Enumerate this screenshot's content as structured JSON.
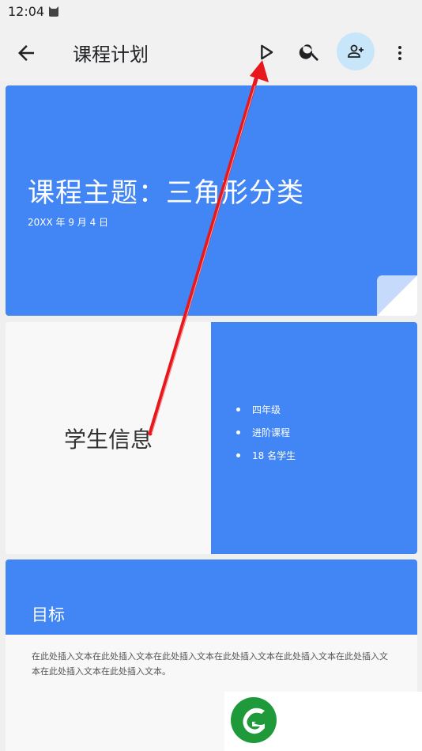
{
  "status": {
    "time": "12:04"
  },
  "appbar": {
    "title": "课程计划"
  },
  "slide1": {
    "title": "课程主题：三角形分类",
    "date": "20XX 年 9 月 4 日"
  },
  "slide2": {
    "left_title": "学生信息",
    "bullets": [
      "四年级",
      "进阶课程",
      "18 名学生"
    ]
  },
  "slide3": {
    "heading": "目标",
    "body": "在此处插入文本在此处插入文本在此处插入文本在此处插入文本在此处插入文本在此处插入文本在此处插入文本在此处插入文本。"
  },
  "colors": {
    "accent": "#4285f4",
    "share_bg": "#c8e6fa",
    "annotation_arrow": "#e8171b"
  }
}
